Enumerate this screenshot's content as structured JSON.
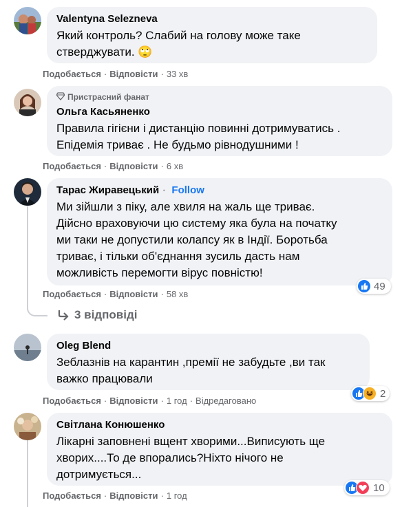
{
  "comments": [
    {
      "name": "Valentyna Selezneva",
      "text": "Який контроль? Слабий на голову може таке\nстверджувати. 🙄",
      "like": "Подобається",
      "reply": "Відповісти",
      "time": "33 хв"
    },
    {
      "badge": "Пристрасний фанат",
      "name": "Ольга Касьяненко",
      "text": "Правила гігієни і дистанцію повинні дотримуватись .\nЕпідемія триває . Не будьмо рівнодушними !",
      "like": "Подобається",
      "reply": "Відповісти",
      "time": "6 хв"
    },
    {
      "name": "Тарас Жиравецький",
      "follow": "Follow",
      "text": "Ми зійшли з піку, але хвиля на жаль ще триває.\nДійсно враховуючи цю систему яка була на початку\nми таки не допустили колапсу як в Індії. Боротьба\nтриває, і тільки об'єднання зусиль дасть нам\nможливість перемогти вірус повністю!",
      "like": "Подобається",
      "reply": "Відповісти",
      "time": "58 хв",
      "reactions": "49",
      "replies": "3 відповіді"
    },
    {
      "name": "Oleg Blend",
      "text": "Зеблазнів на карантин ,премії не забудьте ,ви так\nважко працювали",
      "like": "Подобається",
      "reply": "Відповісти",
      "time": "1 год",
      "edited": "Відредаговано",
      "reactions": "2"
    },
    {
      "name": "Світлана Конюшенко",
      "text": "Лікарні заповнені вщент хворими...Виписують ще\nхворих....То де впорались?Ніхто нічого не\nдотримується...",
      "like": "Подобається",
      "reply": "Відповісти",
      "time": "1 год",
      "reactions": "10"
    }
  ],
  "colors": {
    "accent": "#1877f2",
    "bubble": "#f0f2f5",
    "meta": "#65676b",
    "love": "#f33e58",
    "haha": "#f7b125"
  },
  "icons": [
    "like-icon",
    "love-icon",
    "haha-icon",
    "reply-arrow-icon",
    "gem-icon"
  ]
}
